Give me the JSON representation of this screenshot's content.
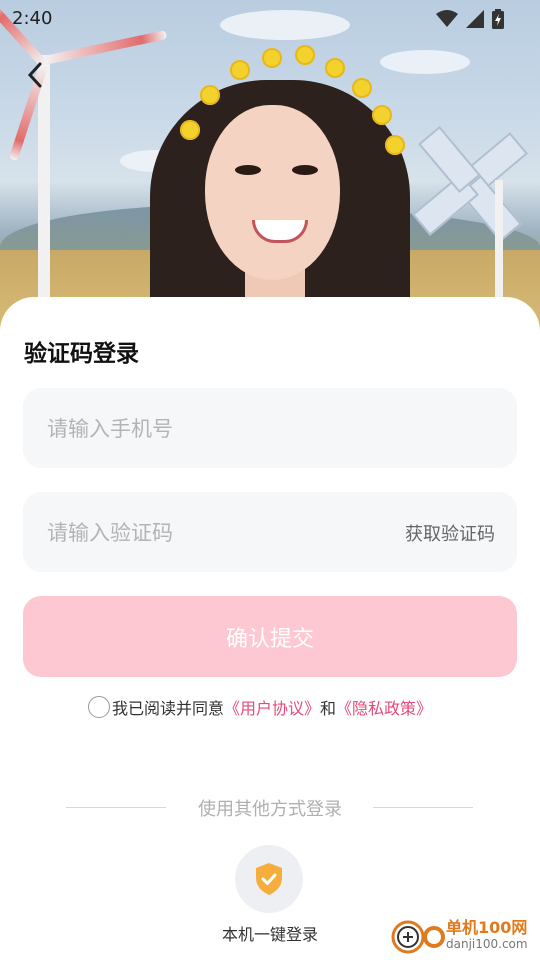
{
  "status_bar": {
    "time": "2:40"
  },
  "login": {
    "title": "验证码登录",
    "phone_placeholder": "请输入手机号",
    "code_placeholder": "请输入验证码",
    "get_code_label": "获取验证码",
    "submit_label": "确认提交",
    "agree_prefix": "我已阅读并同意",
    "user_agreement": "《用户协议》",
    "and_text": "和",
    "privacy_policy": "《隐私政策》"
  },
  "other_login": {
    "divider_text": "使用其他方式登录",
    "quick_login_label": "本机一键登录"
  },
  "watermark": {
    "title": "单机100网",
    "url": "danji100.com"
  },
  "colors": {
    "accent_pink": "#e54a7a",
    "button_disabled": "#fdc8d2",
    "shield": "#f5ad3c"
  }
}
